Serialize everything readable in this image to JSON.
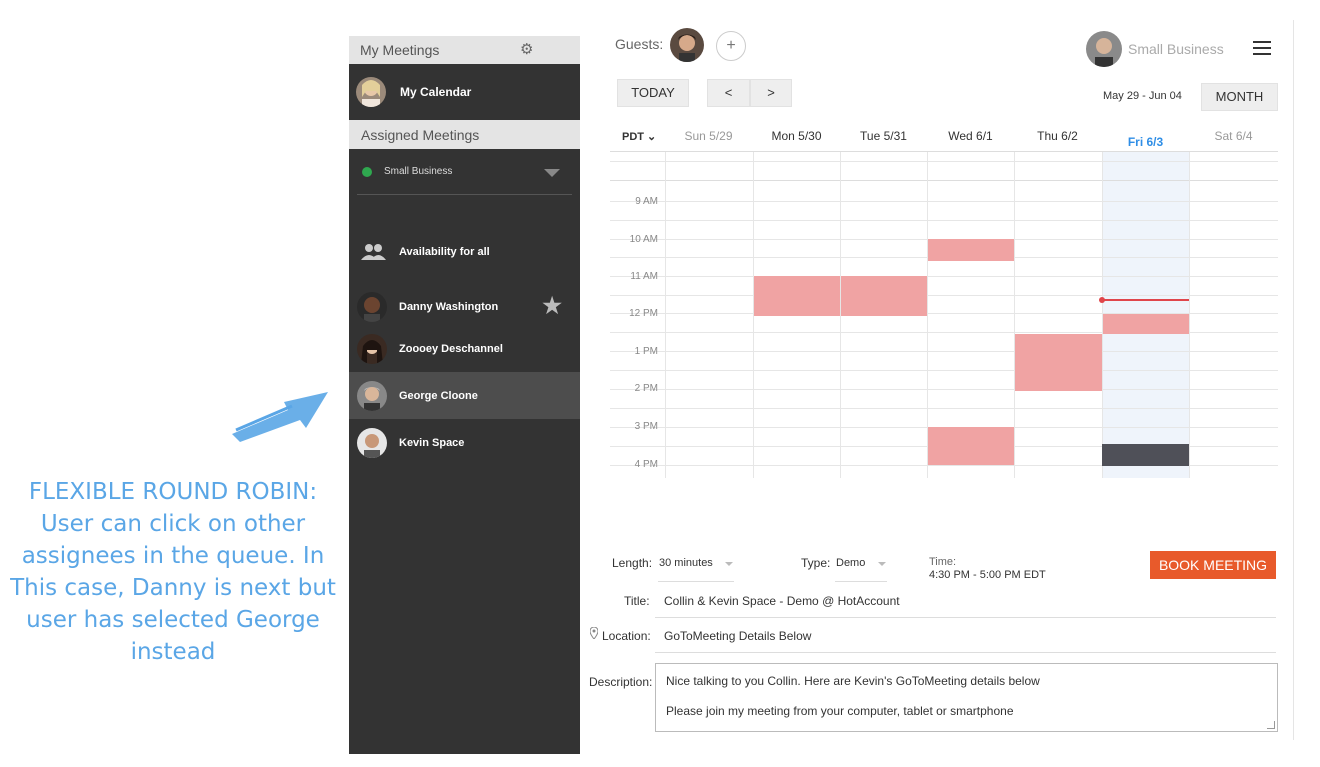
{
  "annotation": {
    "text": "FLEXIBLE ROUND ROBIN: User can click on other assignees in the queue. In This case, Danny is next but user has selected George instead"
  },
  "sidebar": {
    "header": "My Meetings",
    "my_calendar": "My Calendar",
    "assigned_meetings": "Assigned Meetings",
    "business_select": "Small Business",
    "availability": "Availability for all",
    "users": [
      {
        "name": "Danny Washington",
        "starred": true
      },
      {
        "name": "Zoooey Deschannel"
      },
      {
        "name": "George Cloone",
        "selected": true
      },
      {
        "name": "Kevin Space"
      }
    ]
  },
  "header": {
    "guests_label": "Guests:",
    "add_guest": "+",
    "account_name": "Small Business"
  },
  "toolbar": {
    "today": "TODAY",
    "prev": "<",
    "next": ">",
    "range": "May 29 - Jun 04",
    "month": "MONTH"
  },
  "calendar": {
    "timezone": "PDT",
    "days": [
      "Sun 5/29",
      "Mon 5/30",
      "Tue 5/31",
      "Wed 6/1",
      "Thu 6/2",
      "Fri 6/3",
      "Sat 6/4"
    ],
    "times": [
      "9 AM",
      "10 AM",
      "11 AM",
      "12 PM",
      "1 PM",
      "2 PM",
      "3 PM",
      "4 PM"
    ],
    "busy_color": "#f0a3a3",
    "selected_slot_color": "#4f5058",
    "now_line_color": "#e0454a"
  },
  "form": {
    "length_label": "Length:",
    "length_value": "30 minutes",
    "type_label": "Type:",
    "type_value": "Demo",
    "time_label": "Time:",
    "time_value": "4:30 PM - 5:00 PM EDT",
    "book_button": "BOOK MEETING",
    "title_label": "Title:",
    "title_value": "Collin & Kevin Space - Demo @  HotAccount",
    "location_label": "Location:",
    "location_value": "GoToMeeting Details Below",
    "description_label": "Description:",
    "description_line1": "Nice talking to you Collin. Here are Kevin's GoToMeeting details below",
    "description_line2": "Please join my meeting from your computer, tablet or smartphone"
  },
  "colors": {
    "accent_orange": "#e85a2b",
    "sidebar_bg": "#333333",
    "annotation_blue": "#5aa6e6",
    "today_blue": "#2f8ee6"
  }
}
